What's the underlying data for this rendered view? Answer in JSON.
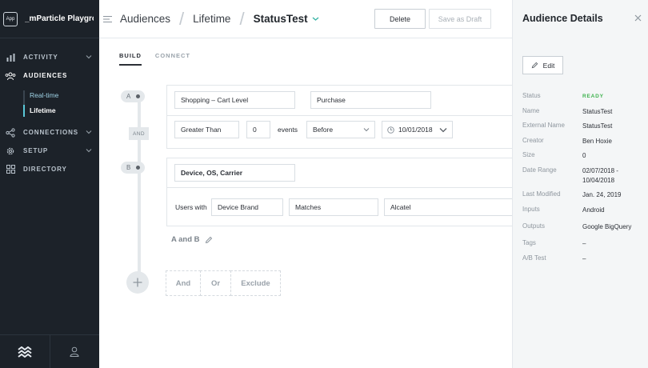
{
  "sidebar": {
    "app_badge": "App",
    "workspace_name": "_mParticle Playground",
    "items": [
      {
        "label": "ACTIVITY",
        "icon": "bar-chart-icon"
      },
      {
        "label": "AUDIENCES",
        "icon": "people-icon"
      },
      {
        "label": "CONNECTIONS",
        "icon": "network-icon"
      },
      {
        "label": "SETUP",
        "icon": "gear-icon"
      },
      {
        "label": "DIRECTORY",
        "icon": "grid-icon"
      }
    ],
    "audiences_sub": [
      "Real-time",
      "Lifetime"
    ]
  },
  "header": {
    "crumb_1": "Audiences",
    "crumb_2": "Lifetime",
    "crumb_3": "StatusTest",
    "delete_label": "Delete",
    "draft_label": "Save as Draft"
  },
  "tabs": [
    "BUILD",
    "CONNECT"
  ],
  "builder": {
    "criterion_a": {
      "badge": "A",
      "event_source": "Shopping – Cart Level",
      "event_name": "Purchase",
      "comparison": "Greater Than",
      "count": "0",
      "count_unit": "events",
      "time_op": "Before",
      "date": "10/01/2018"
    },
    "connector": "AND",
    "criterion_b": {
      "badge": "B",
      "source": "Device, OS, Carrier",
      "users_with": "Users with",
      "attribute": "Device Brand",
      "operator": "Matches",
      "value": "Alcatel"
    },
    "group_label": "A and B",
    "add_buttons": [
      "And",
      "Or",
      "Exclude"
    ]
  },
  "details": {
    "title": "Audience Details",
    "edit_label": "Edit",
    "status_key": "Status",
    "status_val": "READY",
    "name_key": "Name",
    "name_val": "StatusTest",
    "ext_key": "External Name",
    "ext_val": "StatusTest",
    "creator_key": "Creator",
    "creator_val": "Ben Hoxie",
    "size_key": "Size",
    "size_val": "0",
    "range_key": "Date Range",
    "range_val": "02/07/2018 - 10/04/2018",
    "modified_key": "Last Modified",
    "modified_val": "Jan. 24, 2019",
    "inputs_key": "Inputs",
    "inputs_val": "Android",
    "outputs_key": "Outputs",
    "outputs_val": "Google BigQuery",
    "tags_key": "Tags",
    "tags_val": "–",
    "ab_key": "A/B Test",
    "ab_val": "–"
  },
  "colors": {
    "sidebar_bg": "#1c2229",
    "accent": "#5ac8d8",
    "ready": "#3fb34f"
  }
}
